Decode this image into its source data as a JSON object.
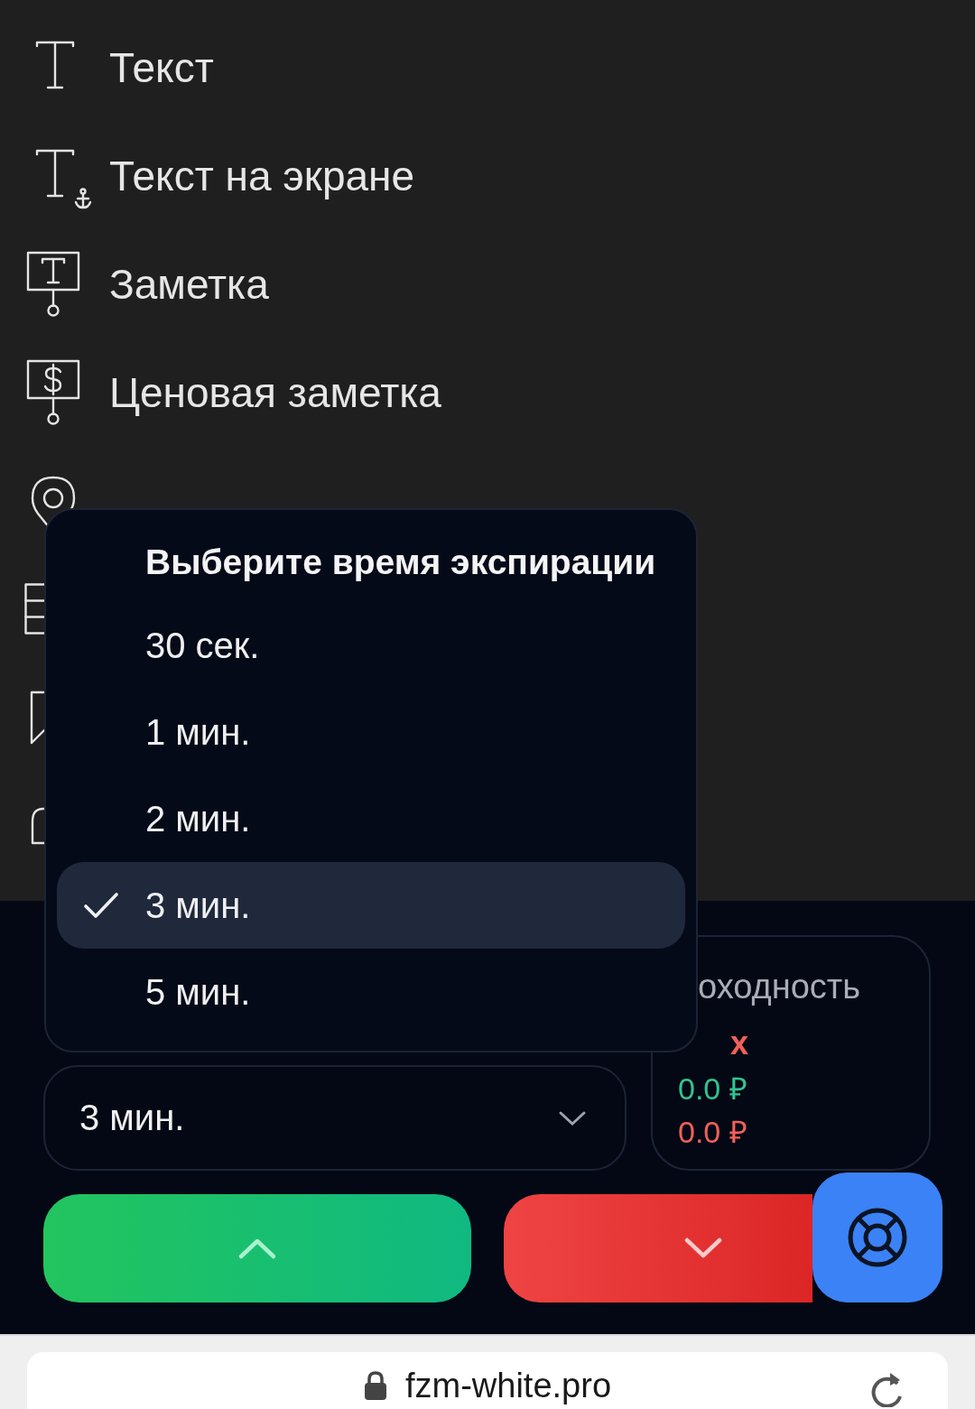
{
  "tools": [
    {
      "kind": "text",
      "label": "Текст"
    },
    {
      "kind": "anchored-text",
      "label": "Текст на экране"
    },
    {
      "kind": "note",
      "label": "Заметка"
    },
    {
      "kind": "price-note",
      "label": "Ценовая заметка"
    },
    {
      "kind": "pin"
    },
    {
      "kind": "table"
    },
    {
      "kind": "flag"
    },
    {
      "kind": "arch"
    }
  ],
  "expiry_popup": {
    "title": "Выберите время экспирации",
    "options": [
      {
        "label": "30 сек.",
        "selected": false
      },
      {
        "label": "1 мин.",
        "selected": false
      },
      {
        "label": "2 мин.",
        "selected": false
      },
      {
        "label": "3 мин.",
        "selected": true
      },
      {
        "label": "5 мин.",
        "selected": false
      }
    ]
  },
  "expiry_select": {
    "value": "3 мин."
  },
  "yield": {
    "title": "оходность",
    "down_multiplier": "x",
    "up_amount": "0.0 ₽",
    "down_amount": "0.0 ₽"
  },
  "browser": {
    "url": "fzm-white.pro"
  }
}
